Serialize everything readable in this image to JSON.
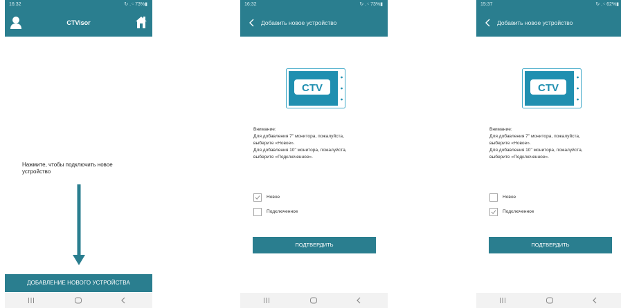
{
  "screens": [
    {
      "status": {
        "time": "16:32",
        "indicators": "↻ .⁖ 73%▮"
      },
      "appbar": {
        "title": "CTVisor",
        "left_icon": "user-icon",
        "right_icon": "home-icon"
      },
      "main": {
        "instruction": "Нажмите, чтобы подключить новое устройство",
        "action_label": "ДОБАВЛЕНИЕ НОВОГО УСТРОЙСТВА"
      }
    },
    {
      "status": {
        "time": "16:32",
        "indicators": "↻ .⁖ 73%▮"
      },
      "appbar": {
        "title": "Добавить новое устройство"
      },
      "logo_text": "CTV",
      "notice": [
        "Внимание:",
        "Для добавления 7\" монитора, пожалуйста,",
        "выберите «Новое».",
        "Для добавления 10\" монитора, пожалуйста,",
        "выберите «Подключенное»."
      ],
      "options": [
        {
          "label": "Новое",
          "checked": true
        },
        {
          "label": "Подключенное",
          "checked": false
        }
      ],
      "confirm_label": "ПОДТВЕРДИТЬ"
    },
    {
      "status": {
        "time": "15:37",
        "indicators": "↻ .⁖ 62%▮"
      },
      "appbar": {
        "title": "Добавить новое устройство"
      },
      "logo_text": "CTV",
      "notice": [
        "Внимание:",
        "Для добавления 7\" монитора, пожалуйста,",
        "выберите «Новое».",
        "Для добавления 10\" монитора, пожалуйста,",
        "выберите «Подключенное»."
      ],
      "options": [
        {
          "label": "Новое",
          "checked": false
        },
        {
          "label": "Подключенное",
          "checked": true
        }
      ],
      "confirm_label": "ПОДТВЕРДИТЬ"
    }
  ],
  "navbar": {
    "icons": [
      "recent-apps-icon",
      "home-circle-icon",
      "back-chevron-icon"
    ]
  },
  "colors": {
    "accent": "#2a7e8f",
    "checkbox_border": "#a6a6a6",
    "navbar_bg": "#f2f2f2",
    "logo_blue": "#1f8fb0"
  }
}
